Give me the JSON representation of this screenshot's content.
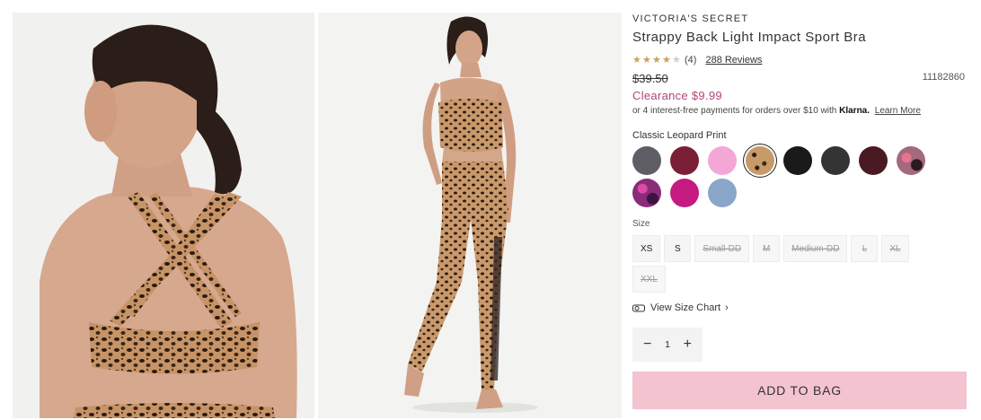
{
  "product": {
    "brand": "VICTORIA'S SECRET",
    "title": "Strappy Back Light Impact Sport Bra",
    "rating": {
      "stars": 4,
      "max": 5,
      "count_label": "(4)",
      "reviews_label": "288 Reviews"
    },
    "original_price": "$39.50",
    "sku": "11182860",
    "sale_price": "Clearance $9.99",
    "installments": {
      "text": "or 4 interest-free payments for orders over $10 with",
      "provider": "Klarna.",
      "link": "Learn More"
    }
  },
  "color": {
    "selected_label": "Classic Leopard Print",
    "swatches": [
      {
        "name": "heather-grey",
        "color": "#5f5e66"
      },
      {
        "name": "burgundy",
        "color": "#7a1f35"
      },
      {
        "name": "pink",
        "color": "#f4a6d6"
      },
      {
        "name": "classic-leopard",
        "color": "#c79a6a",
        "selected": true
      },
      {
        "name": "black",
        "color": "#1a1a1a"
      },
      {
        "name": "charcoal-print",
        "color": "#333433"
      },
      {
        "name": "dark-print",
        "color": "#4a1a22"
      },
      {
        "name": "pink-floral",
        "color": "#a26a7c"
      },
      {
        "name": "purple-floral",
        "color": "#8a2c7a"
      },
      {
        "name": "magenta",
        "color": "#c51a7f"
      },
      {
        "name": "blue",
        "color": "#8aa6c8"
      }
    ]
  },
  "size": {
    "label": "Size",
    "options": [
      {
        "label": "XS",
        "available": true
      },
      {
        "label": "S",
        "available": true
      },
      {
        "label": "Small-DD",
        "available": false
      },
      {
        "label": "M",
        "available": false
      },
      {
        "label": "Medium-DD",
        "available": false
      },
      {
        "label": "L",
        "available": false
      },
      {
        "label": "XL",
        "available": false
      },
      {
        "label": "XXL",
        "available": false
      }
    ],
    "chart_link": "View Size Chart"
  },
  "quantity": {
    "value": "1",
    "minus": "−",
    "plus": "+"
  },
  "cta": {
    "add_to_bag": "ADD TO BAG"
  },
  "icons": {
    "star": "★",
    "chevron": "chevron-right-icon",
    "tape": "measuring-tape-icon"
  }
}
